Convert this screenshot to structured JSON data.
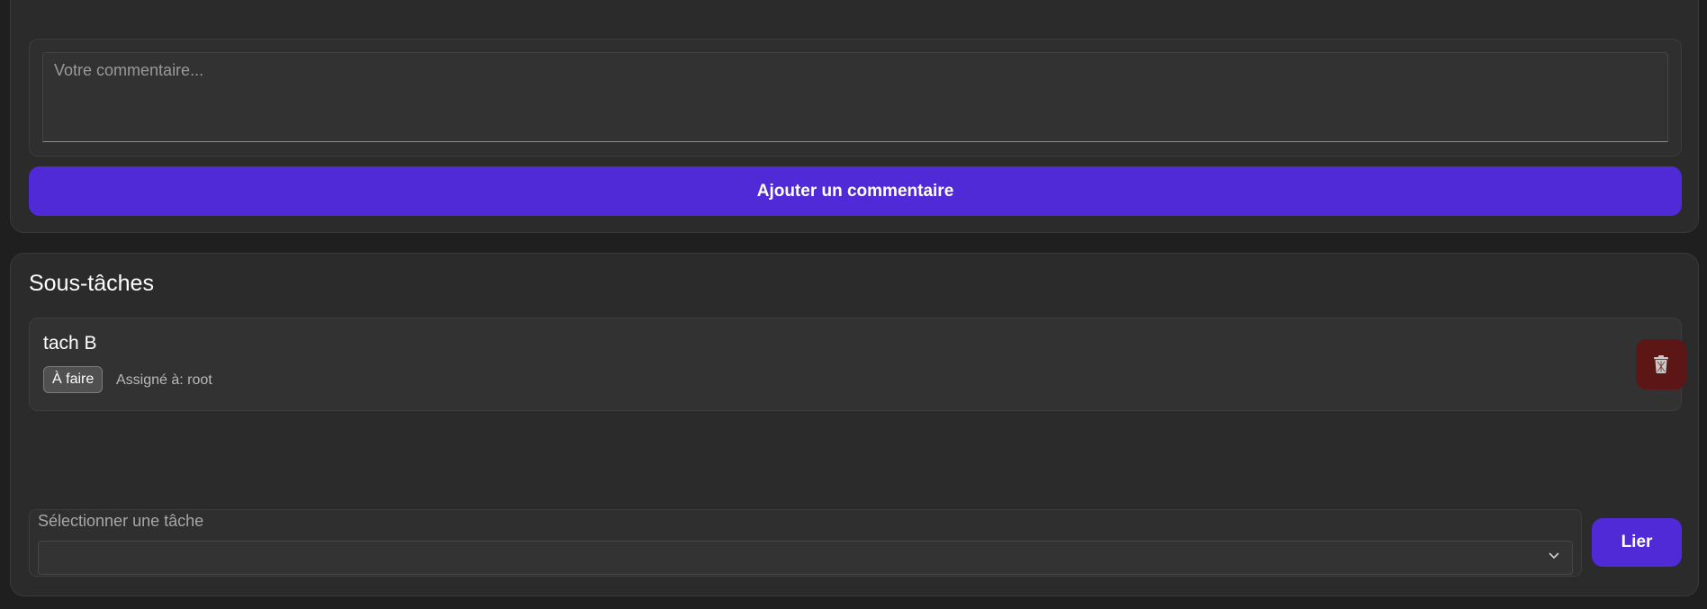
{
  "comments": {
    "textarea_placeholder": "Votre commentaire...",
    "textarea_value": "",
    "add_button_label": "Ajouter un commentaire"
  },
  "subtasks": {
    "title": "Sous-tâches",
    "items": [
      {
        "title": "tach B",
        "status": "À faire",
        "assignee_text": "Assigné à: root",
        "delete_icon": "trash-icon"
      }
    ],
    "link_form": {
      "select_label": "Sélectionner une tâche",
      "selected_value": "",
      "link_button_label": "Lier"
    }
  },
  "colors": {
    "background": "#1f1f1f",
    "card": "#2b2b2b",
    "primary": "#4f2ad6",
    "danger": "#5c1616",
    "badge": "#505050"
  }
}
